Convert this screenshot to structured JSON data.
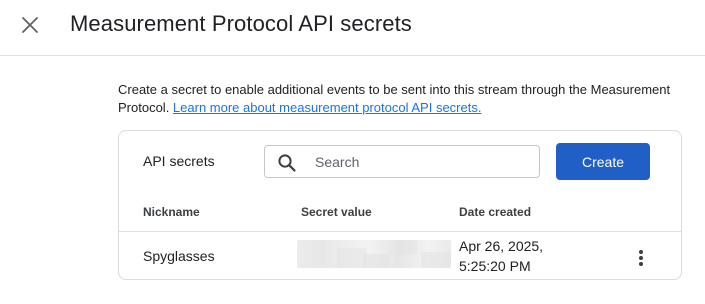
{
  "dialog": {
    "title": "Measurement Protocol API secrets",
    "close_icon": "close-icon"
  },
  "intro": {
    "text": "Create a secret to enable additional events to be sent into this stream through the Measurement Protocol. ",
    "link_text": "Learn more about measurement protocol API secrets."
  },
  "card": {
    "title": "API secrets",
    "search": {
      "icon": "search-icon",
      "placeholder": "Search",
      "value": ""
    },
    "create_label": "Create",
    "columns": [
      "Nickname",
      "Secret value",
      "Date created"
    ],
    "rows": [
      {
        "nickname": "Spyglasses",
        "secret_value_obscured": true,
        "date_created_line1": "Apr 26, 2025,",
        "date_created_line2": "5:25:20 PM",
        "menu_icon": "more-vert-icon"
      }
    ]
  },
  "colors": {
    "accent": "#1a73e8",
    "button": "#1f5fc6",
    "text": "#202124",
    "border": "#dadce0"
  }
}
